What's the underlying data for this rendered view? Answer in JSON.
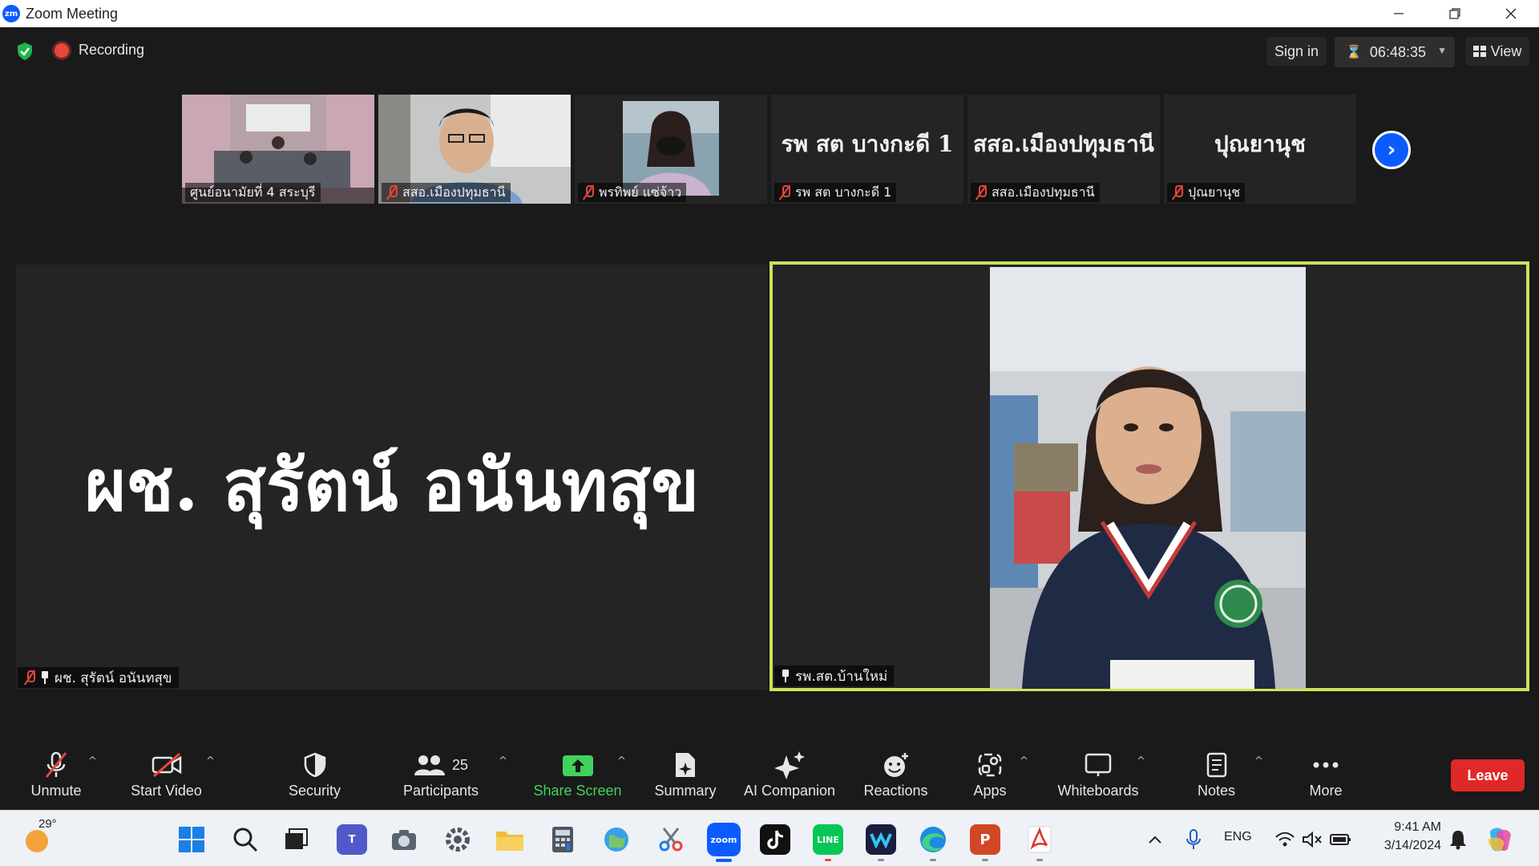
{
  "window": {
    "logo": "zm",
    "title": "Zoom Meeting",
    "controls": [
      "minimize",
      "restore",
      "close"
    ]
  },
  "topbar": {
    "recording_label": "Recording",
    "sign_in_label": "Sign in",
    "timer": "06:48:35",
    "view_label": "View"
  },
  "thumbnails": [
    {
      "name": "ศูนย์อนามัยที่ 4 สระบุรี",
      "type": "video",
      "muted": false
    },
    {
      "name": "สสอ.เมืองปทุมธานี",
      "type": "video",
      "muted": true
    },
    {
      "name": "พรทิพย์ แซ่จ้าว",
      "type": "video",
      "muted": true
    },
    {
      "name": "รพ สต บางกะดี 1",
      "display": "รพ สต บางกะดี 1",
      "type": "name",
      "muted": true
    },
    {
      "name": "สสอ.เมืองปทุมธานี",
      "display": "สสอ.เมืองปทุมธานี",
      "type": "name",
      "muted": true
    },
    {
      "name": "ปุณยานุช",
      "display": "ปุณยานุช",
      "type": "name",
      "muted": true
    }
  ],
  "main": {
    "left_tile": {
      "display_name": "ผช. สุรัตน์ อนันทสุข",
      "label": "ผช. สุรัตน์ อนันทสุข",
      "muted": true,
      "pinned": true
    },
    "right_tile": {
      "label": "รพ.สต.บ้านใหม่",
      "pinned": true,
      "active_speaker_color": "#c8e45a"
    }
  },
  "toolbar": {
    "unmute": "Unmute",
    "start_video": "Start Video",
    "security": "Security",
    "participants": "Participants",
    "participant_count": "25",
    "share_screen": "Share Screen",
    "summary": "Summary",
    "ai_companion": "AI Companion",
    "reactions": "Reactions",
    "apps": "Apps",
    "whiteboards": "Whiteboards",
    "notes": "Notes",
    "more": "More",
    "leave": "Leave"
  },
  "taskbar": {
    "temperature": "29°",
    "language": "ENG",
    "time": "9:41 AM",
    "date": "3/14/2024",
    "apps": [
      "start-icon",
      "search-icon",
      "task-view-icon",
      "teams-icon",
      "camera-icon",
      "settings-icon",
      "file-explorer-icon",
      "calculator-icon",
      "maps-icon",
      "snipping-tool-icon",
      "zoom-icon",
      "tiktok-icon",
      "line-icon",
      "webex-icon",
      "edge-icon",
      "powerpoint-icon",
      "acrobat-icon"
    ],
    "line_label": "LINE",
    "zoom_label": "zoom",
    "ppt_label": "P"
  },
  "colors": {
    "accent": "#0b5cff",
    "share_green": "#3fd35c",
    "leave_red": "#e02828",
    "muted_red": "#e8453c"
  }
}
